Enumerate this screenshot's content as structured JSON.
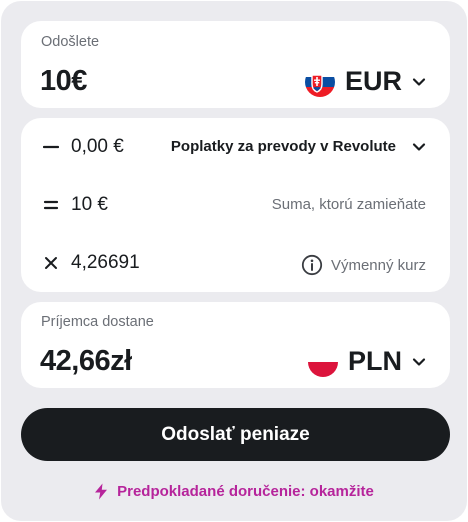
{
  "send": {
    "label": "Odošlete",
    "amount": "10€",
    "currency": "EUR",
    "flag_icon": "slovakia-flag-icon"
  },
  "fees": [
    {
      "operator": "minus-icon",
      "value": "0,00 €",
      "label": "Poplatky za prevody v Revolute",
      "has_dropdown": true
    },
    {
      "operator": "equals-icon",
      "value": "10 €",
      "label": "Suma, ktorú zamieňate"
    },
    {
      "operator": "multiply-icon",
      "value": "4,26691",
      "label": "Výmenný kurz",
      "has_info_icon": true
    }
  ],
  "receive": {
    "label": "Príjemca dostane",
    "amount": "42,66zł",
    "currency": "PLN",
    "flag_icon": "poland-flag-icon"
  },
  "button": {
    "label": "Odoslať peniaze"
  },
  "delivery": {
    "text": "Predpokladané doručenie: okamžite",
    "icon": "lightning-icon"
  },
  "colors": {
    "background": "#ebebef",
    "card": "#ffffff",
    "button": "#191c1f",
    "accent_delivery": "#b6249b",
    "muted_text": "#6b6f76"
  }
}
